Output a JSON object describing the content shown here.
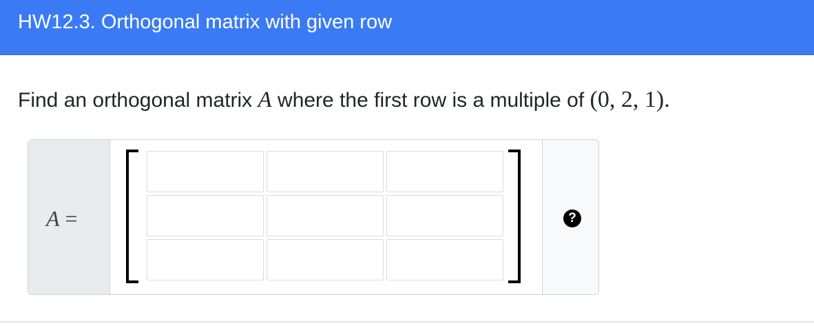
{
  "header": {
    "title": "HW12.3. Orthogonal matrix with given row"
  },
  "question": {
    "text_before": "Find an orthogonal matrix ",
    "variable": "A",
    "text_middle": " where the first row is a multiple of ",
    "vector": "(0, 2, 1)",
    "text_after": "."
  },
  "answer": {
    "label_variable": "A",
    "label_equals": " =",
    "matrix_rows": 3,
    "matrix_cols": 3,
    "cell_values": [
      [
        "",
        "",
        ""
      ],
      [
        "",
        "",
        ""
      ],
      [
        "",
        "",
        ""
      ]
    ],
    "help_icon": "question-circle-icon",
    "help_glyph": "?"
  },
  "colors": {
    "header_bg": "#3a7bf5",
    "header_text": "#ffffff",
    "addon_bg": "#e9ecef",
    "border": "#ced4da"
  }
}
